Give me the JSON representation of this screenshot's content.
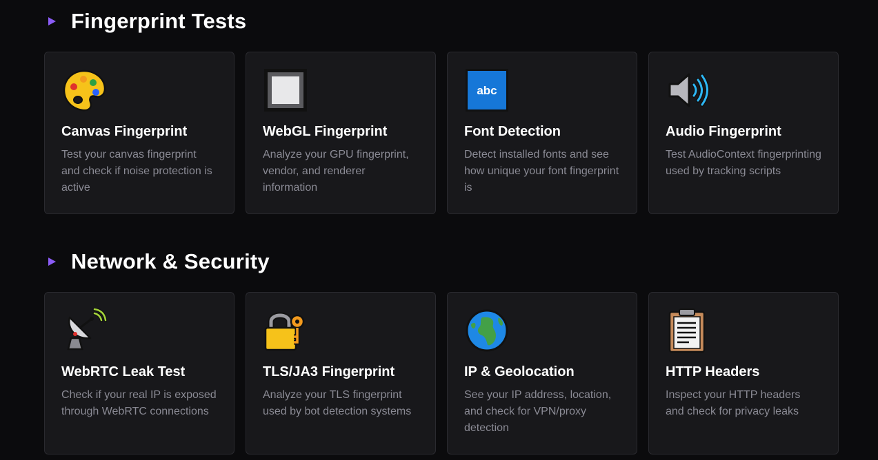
{
  "sections": [
    {
      "title": "Fingerprint Tests",
      "cards": [
        {
          "icon": "palette-icon",
          "title": "Canvas Fingerprint",
          "description": "Test your canvas fingerprint and check if noise protection is active"
        },
        {
          "icon": "square-frame-icon",
          "title": "WebGL Fingerprint",
          "description": "Analyze your GPU fingerprint, vendor, and renderer information"
        },
        {
          "icon": "abc-icon",
          "title": "Font Detection",
          "description": "Detect installed fonts and see how unique your font fingerprint is",
          "icon_text": "abc"
        },
        {
          "icon": "speaker-icon",
          "title": "Audio Fingerprint",
          "description": "Test AudioContext fingerprinting used by tracking scripts"
        }
      ]
    },
    {
      "title": "Network & Security",
      "cards": [
        {
          "icon": "satellite-dish-icon",
          "title": "WebRTC Leak Test",
          "description": "Check if your real IP is exposed through WebRTC connections"
        },
        {
          "icon": "lock-key-icon",
          "title": "TLS/JA3 Fingerprint",
          "description": "Analyze your TLS fingerprint used by bot detection systems"
        },
        {
          "icon": "globe-icon",
          "title": "IP & Geolocation",
          "description": "See your IP address, location, and check for VPN/proxy detection"
        },
        {
          "icon": "clipboard-icon",
          "title": "HTTP Headers",
          "description": "Inspect your HTTP headers and check for privacy leaks"
        }
      ]
    }
  ],
  "colors": {
    "background": "#0b0b0d",
    "card": "#18181b",
    "accent": "#8b5cf6",
    "muted_text": "#8a8a94"
  }
}
